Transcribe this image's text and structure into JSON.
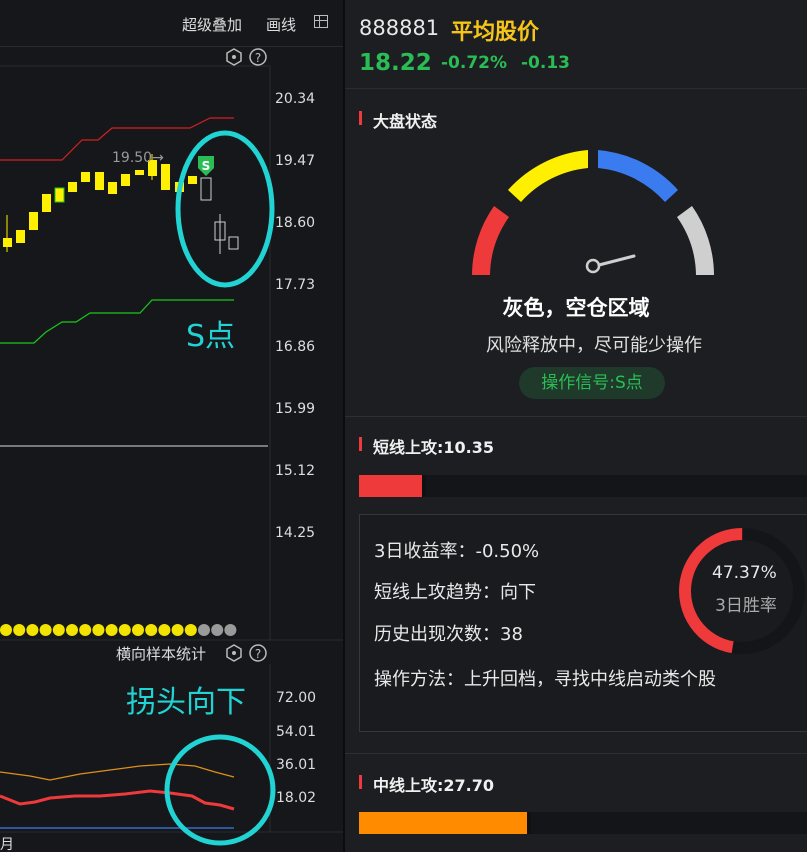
{
  "toolbar": {
    "overlay_label": "超级叠加",
    "draw_label": "画线"
  },
  "main_chart": {
    "price_ticks": [
      "20.34",
      "19.47",
      "18.60",
      "17.73",
      "16.86",
      "15.99",
      "15.12",
      "14.25"
    ],
    "high_label": "19.50→",
    "signal_marker": "S",
    "annotation": "S点"
  },
  "sub_chart": {
    "title": "横向样本统计",
    "value_ticks": [
      "72.00",
      "54.01",
      "36.01",
      "18.02"
    ],
    "annotation": "拐头向下",
    "x_label": "月"
  },
  "stock": {
    "code": "888881",
    "name": "平均股价",
    "price": "18.22",
    "change_pct": "-0.72%",
    "change": "-0.13"
  },
  "market": {
    "title": "大盘状态",
    "state": "灰色，空仓区域",
    "description": "风险释放中，尽可能少操作",
    "signal": "操作信号:S点"
  },
  "short_term": {
    "title": "短线上攻:10.35",
    "bar_fraction": 0.1035,
    "return_3d": "3日收益率：-0.50%",
    "trend": "短线上攻趋势：向下",
    "occurrences": "历史出现次数：38",
    "method": "操作方法：上升回档，寻找中线启动类个股",
    "win_rate": "47.37%",
    "win_rate_label": "3日胜率",
    "win_rate_fraction": 0.4737
  },
  "mid_term": {
    "title": "中线上攻:27.70",
    "bar_fraction": 0.277
  },
  "colors": {
    "accent_red": "#ee3a3a",
    "up_yellow": "#ffef00",
    "down_green": "#2bbd55",
    "cyan": "#22d3d3",
    "orange": "#ff8c00",
    "gray": "#cfcfcf",
    "blue": "#3a7bf0"
  }
}
